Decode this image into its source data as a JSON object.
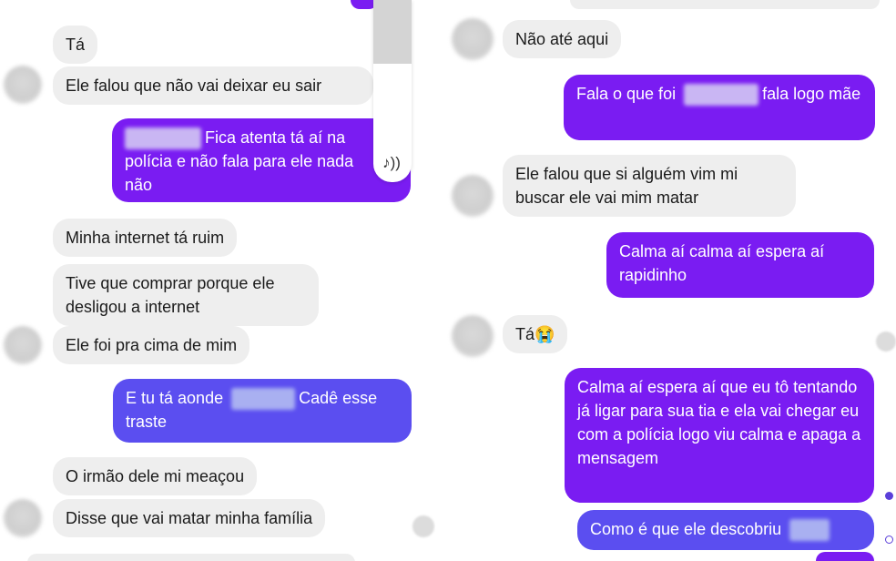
{
  "left": {
    "messages": [
      {
        "text": "Tá"
      },
      {
        "text": "Ele falou que não vai deixar eu sair"
      },
      {
        "text_after_redaction": "Fica atenta tá aí na polícia e não fala para ele nada não"
      },
      {
        "text": "Minha internet tá ruim"
      },
      {
        "text": "Tive que comprar porque ele desligou a internet"
      },
      {
        "text": "Ele foi pra cima de mim"
      },
      {
        "text_before_redaction": "E tu tá aonde",
        "text_after_redaction": "Cadê esse traste"
      },
      {
        "text": "O irmão dele mi meaçou"
      },
      {
        "text": "Disse que vai matar minha família"
      }
    ],
    "audio_icon": "♪))"
  },
  "right": {
    "messages": [
      {
        "text": "Não até aqui"
      },
      {
        "text_before_redaction": "Fala o que foi",
        "text_after_redaction": "fala logo mãe"
      },
      {
        "text": "Ele falou que si alguém vim mi buscar ele vai mim matar"
      },
      {
        "text": "Calma aí calma aí espera aí rapidinho"
      },
      {
        "text": "Tá",
        "emoji": "😭"
      },
      {
        "text": "Calma aí espera aí que eu tô tentando já ligar para sua tia e ela vai chegar eu com a polícia logo viu calma e apaga a mensagem"
      },
      {
        "text": "Como é que ele descobriu"
      }
    ]
  },
  "colors": {
    "outgoing_violet": "#7a1cf2",
    "outgoing_blue": "#5b4ef0",
    "incoming_gray": "#eeeeee"
  }
}
